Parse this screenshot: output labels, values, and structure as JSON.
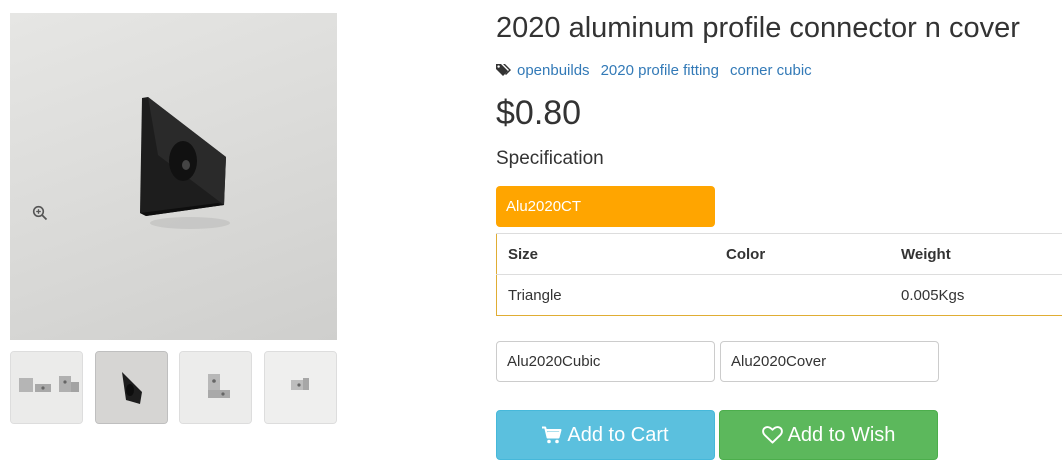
{
  "product": {
    "title": "2020 aluminum profile connector n cover",
    "tags": [
      "openbuilds",
      "2020 profile fitting",
      "corner cubic"
    ],
    "price": "$0.80"
  },
  "gallery": {
    "zoom_icon": "zoom-in-icon",
    "thumbnail_count": 4,
    "active_thumbnail": 2
  },
  "specification": {
    "heading": "Specification",
    "selected": "Alu2020CT",
    "table": {
      "headers": [
        "Size",
        "Color",
        "Weight"
      ],
      "rows": [
        [
          "Triangle",
          "",
          "0.005Kgs"
        ]
      ]
    },
    "options": [
      "Alu2020Cubic",
      "Alu2020Cover"
    ]
  },
  "actions": {
    "add_to_cart": "Add to Cart",
    "add_to_wish": "Add to Wish",
    "cart_icon": "shopping-cart-icon",
    "wish_icon": "heart-icon"
  },
  "colors": {
    "selected_spec": "#ffa500",
    "cart_button": "#5bc0de",
    "wish_button": "#5cb85c",
    "link": "#337ab7"
  }
}
